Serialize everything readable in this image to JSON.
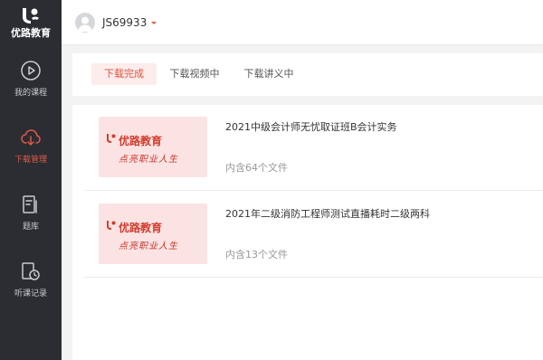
{
  "logo": {
    "text": "优路教育"
  },
  "sidebar": {
    "items": [
      {
        "label": "我的课程",
        "icon": "play-circle-icon",
        "active": false
      },
      {
        "label": "下载管理",
        "icon": "cloud-download-icon",
        "active": true
      },
      {
        "label": "题库",
        "icon": "question-bank-icon",
        "active": false
      },
      {
        "label": "听课记录",
        "icon": "history-record-icon",
        "active": false
      }
    ]
  },
  "header": {
    "username": "JS69933"
  },
  "tabs": [
    {
      "label": "下载完成",
      "active": true
    },
    {
      "label": "下载视频中",
      "active": false
    },
    {
      "label": "下载讲义中",
      "active": false
    }
  ],
  "downloads": [
    {
      "thumb_brand": "优路教育",
      "thumb_slogan": "点亮职业人生",
      "title": "2021中级会计师无忧取证班B会计实务",
      "count": "内含64个文件"
    },
    {
      "thumb_brand": "优路教育",
      "thumb_slogan": "点亮职业人生",
      "title": "2021年二级消防工程师测试直播耗时二级两科",
      "count": "内含13个文件"
    }
  ],
  "colors": {
    "accent": "#e0533f",
    "sidebar_bg": "#2b2d33"
  }
}
